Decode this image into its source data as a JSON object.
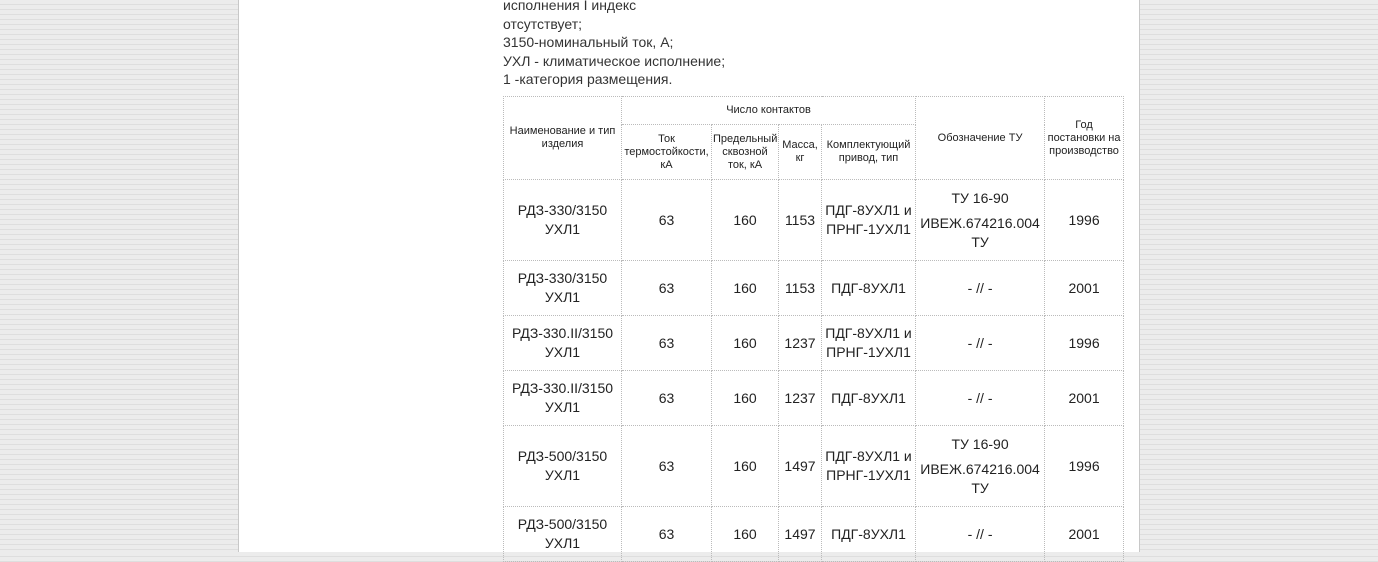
{
  "intro_lines": [
    "исполнения I индекс",
    "отсутствует;",
    "3150-номинальный ток, А;",
    "УХЛ - климатическое исполнение;",
    "1 -категория размещения."
  ],
  "table": {
    "headers": {
      "name": "Наименование и тип изделия",
      "contacts_group": "Число контактов",
      "thermal": "Ток термостойкости, кА",
      "peak": "Предельный сквозной ток, кА",
      "mass": "Масса, кг",
      "drive": "Комплектующий привод, тип",
      "tu": "Обозначение ТУ",
      "year": "Год постановки на производство"
    },
    "rows": [
      {
        "name": "РДЗ-330/3150 УХЛ1",
        "thermal": "63",
        "peak": "160",
        "mass": "1153",
        "drive": "ПДГ-8УХЛ1 и ПРНГ-1УХЛ1",
        "tu_top": "ТУ 16-90",
        "tu_bottom": "ИВЕЖ.674216.004 ТУ",
        "year": "1996"
      },
      {
        "name": "РДЗ-330/3150 УХЛ1",
        "thermal": "63",
        "peak": "160",
        "mass": "1153",
        "drive": "ПДГ-8УХЛ1",
        "tu_top": "",
        "tu_bottom": "- // -",
        "year": "2001"
      },
      {
        "name": "РДЗ-330.II/3150 УХЛ1",
        "thermal": "63",
        "peak": "160",
        "mass": "1237",
        "drive": "ПДГ-8УХЛ1 и ПРНГ-1УХЛ1",
        "tu_top": "",
        "tu_bottom": "- // -",
        "year": "1996"
      },
      {
        "name": "РДЗ-330.II/3150 УХЛ1",
        "thermal": "63",
        "peak": "160",
        "mass": "1237",
        "drive": "ПДГ-8УХЛ1",
        "tu_top": "",
        "tu_bottom": "- // -",
        "year": "2001"
      },
      {
        "name": "РДЗ-500/3150 УХЛ1",
        "thermal": "63",
        "peak": "160",
        "mass": "1497",
        "drive": "ПДГ-8УХЛ1 и ПРНГ-1УХЛ1",
        "tu_top": "ТУ 16-90",
        "tu_bottom": "ИВЕЖ.674216.004 ТУ",
        "year": "1996"
      },
      {
        "name": "РДЗ-500/3150 УХЛ1",
        "thermal": "63",
        "peak": "160",
        "mass": "1497",
        "drive": "ПДГ-8УХЛ1",
        "tu_top": "",
        "tu_bottom": "- // -",
        "year": "2001"
      }
    ]
  }
}
